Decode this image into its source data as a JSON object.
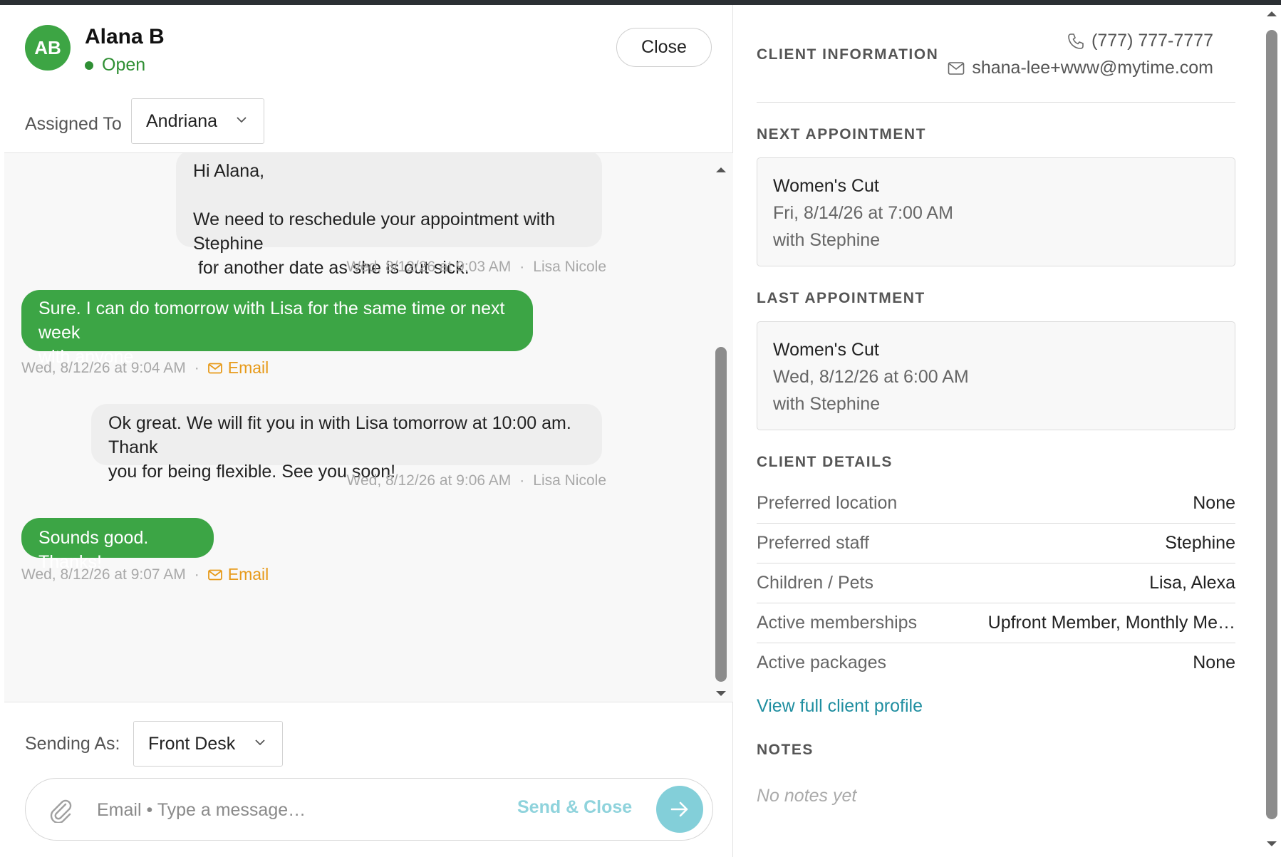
{
  "conversation": {
    "avatar_initials": "AB",
    "client_name": "Alana B",
    "status": "Open",
    "close_label": "Close",
    "assigned_label": "Assigned To",
    "assigned_value": "Andriana",
    "sending_label": "Sending As:",
    "sending_value": "Front Desk",
    "composer_placeholder": "Email • Type a message…",
    "send_close_label": "Send & Close"
  },
  "messages": [
    {
      "text": "Hi Alana,\n\nWe need to reschedule your appointment with Stephine\n for another date as she is out sick.",
      "time": "Wed, 8/12/26 at 9:03 AM",
      "sender": "Lisa Nicole",
      "sep": "·"
    },
    {
      "text": "Sure. I can do tomorrow with Lisa for the same time or next week\nwith anyone.",
      "time": "Wed, 8/12/26 at 9:04 AM",
      "channel": "Email",
      "sep": "·"
    },
    {
      "text": "Ok great. We will fit you in with Lisa tomorrow at 10:00 am. Thank\nyou for being flexible. See you soon!",
      "time": "Wed, 8/12/26 at 9:06 AM",
      "sender": "Lisa Nicole",
      "sep": "·"
    },
    {
      "text": "Sounds good. Thanks!",
      "time": "Wed, 8/12/26 at 9:07 AM",
      "channel": "Email",
      "sep": "·"
    }
  ],
  "client_info": {
    "title": "CLIENT INFORMATION",
    "phone": "(777) 777-7777",
    "email": "shana-lee+www@mytime.com"
  },
  "next_appointment": {
    "title": "NEXT APPOINTMENT",
    "service": "Women's Cut",
    "datetime": "Fri, 8/14/26 at 7:00 AM",
    "staff": "with Stephine"
  },
  "last_appointment": {
    "title": "LAST APPOINTMENT",
    "service": "Women's Cut",
    "datetime": "Wed, 8/12/26 at 6:00 AM",
    "staff": "with Stephine"
  },
  "client_details": {
    "title": "CLIENT DETAILS",
    "rows": [
      {
        "label": "Preferred location",
        "value": "None"
      },
      {
        "label": "Preferred staff",
        "value": "Stephine"
      },
      {
        "label": "Children / Pets",
        "value": "Lisa, Alexa"
      },
      {
        "label": "Active memberships",
        "value": "Upfront Member, Monthly Me…"
      },
      {
        "label": "Active packages",
        "value": "None"
      }
    ],
    "profile_link": "View full client profile"
  },
  "notes": {
    "title": "NOTES",
    "empty_text": "No notes yet"
  },
  "colors": {
    "accent_green": "#3ca545",
    "email_orange": "#e79a19",
    "link_teal": "#1f8ea0",
    "send_teal": "#83cfd9"
  }
}
